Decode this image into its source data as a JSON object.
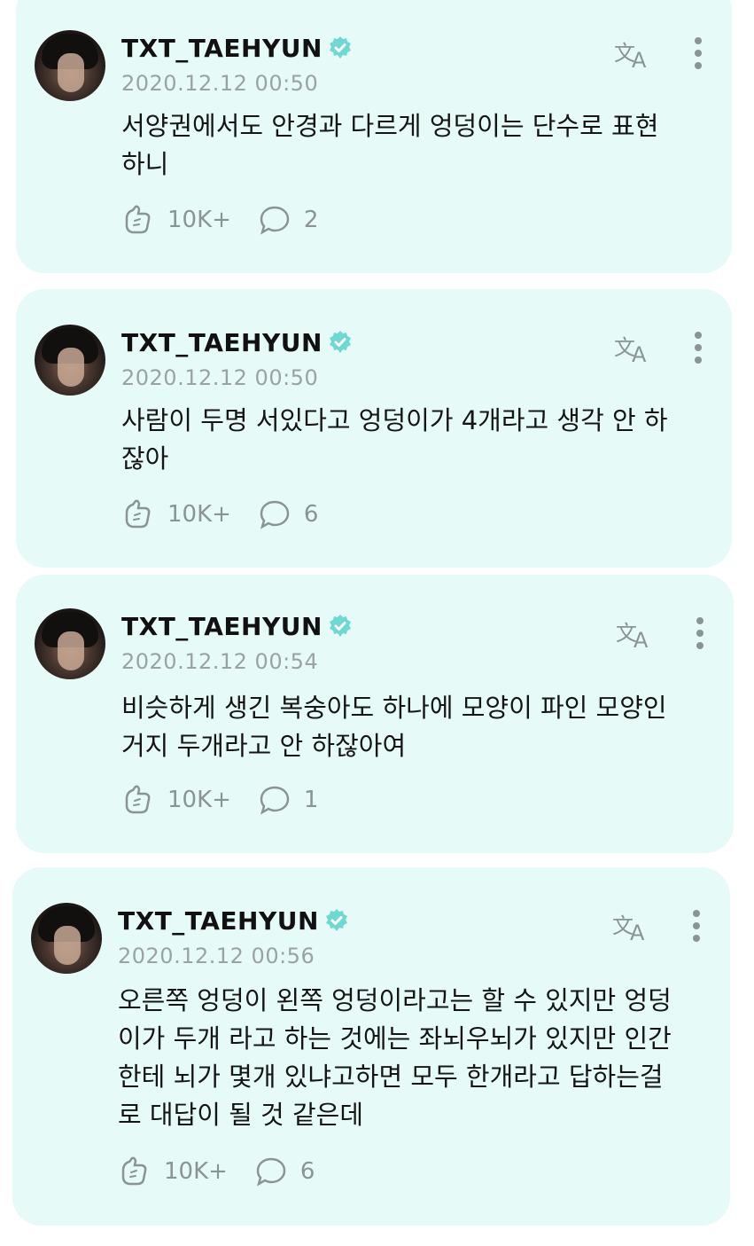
{
  "colors": {
    "card_background": "#e6fbf8",
    "verified_badge": "#6fd8d3",
    "muted_text": "#9aa3a2"
  },
  "posts": [
    {
      "username": "TXT_TAEHYUN",
      "date": "2020.12.12 00:50",
      "text_lines": [
        "서양권에서도 안경과 다르게 엉덩이는 단수로 표현",
        "하니"
      ],
      "likes": "10K+",
      "comments": "2"
    },
    {
      "username": "TXT_TAEHYUN",
      "date": "2020.12.12 00:50",
      "text_lines": [
        "사람이 두명 서있다고 엉덩이가 4개라고 생각 안 하",
        "잖아"
      ],
      "likes": "10K+",
      "comments": "6"
    },
    {
      "username": "TXT_TAEHYUN",
      "date": "2020.12.12 00:54",
      "text_lines": [
        "비슷하게 생긴 복숭아도 하나에 모양이 파인 모양인",
        "거지 두개라고 안 하잖아여"
      ],
      "likes": "10K+",
      "comments": "1"
    },
    {
      "username": "TXT_TAEHYUN",
      "date": "2020.12.12 00:56",
      "text_lines": [
        "오른쪽 엉덩이 왼쪽 엉덩이라고는 할 수 있지만 엉덩",
        "이가 두개 라고 하는 것에는 좌뇌우뇌가 있지만 인간",
        "한테 뇌가 몇개 있냐고하면 모두 한개라고 답하는걸",
        "로 대답이 될 것 같은데"
      ],
      "likes": "10K+",
      "comments": "6"
    }
  ],
  "icons": {
    "avatar": "avatar",
    "verified": "verified-badge-icon",
    "translate": "translate-icon",
    "more": "more-vertical-icon",
    "like": "like-hand-icon",
    "comment": "comment-bubble-icon"
  }
}
